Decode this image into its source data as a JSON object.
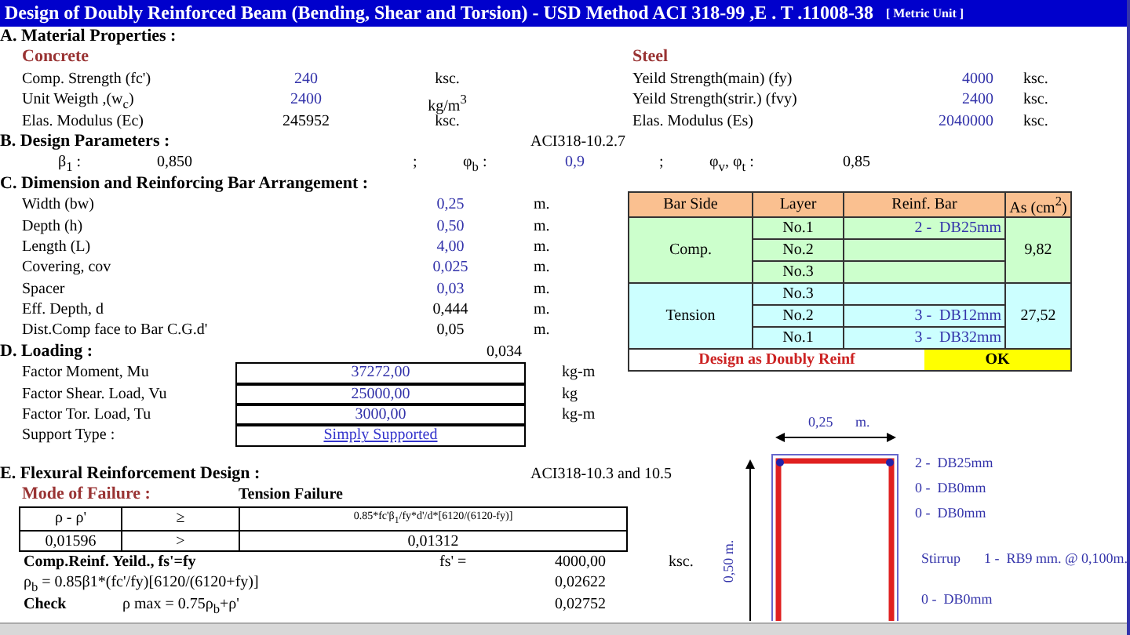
{
  "title": {
    "text": "Design of Doubly Reinforced Beam (Bending, Shear and Torsion) - USD Method ACI 318-99 ,E . T .11008-38",
    "unit_tag": "[ Metric Unit ]"
  },
  "material": {
    "heading": "A. Material Properties :",
    "concrete": {
      "heading": "Concrete",
      "rows": [
        {
          "label": "Comp. Strength (fc')",
          "value": "240",
          "unit": "ksc.",
          "input": true
        },
        {
          "label": "Unit Weigth ,(w$_{c}$)",
          "value": "2400",
          "unit": "kg/m$^{3}$",
          "input": true
        },
        {
          "label": "Elas. Modulus (Ec)",
          "value": "245952",
          "unit": "ksc.",
          "input": false
        }
      ]
    },
    "steel": {
      "heading": "Steel",
      "rows": [
        {
          "label": "Yeild Strength(main) (fy)",
          "value": "4000",
          "unit": "ksc.",
          "input": true
        },
        {
          "label": "Yeild Strength(strir.) (fvy)",
          "value": "2400",
          "unit": "ksc.",
          "input": true
        },
        {
          "label": "Elas. Modulus (Es)",
          "value": "2040000",
          "unit": "ksc.",
          "input": true
        }
      ]
    }
  },
  "design_parameters": {
    "heading": "B. Design Parameters :",
    "reference": "ACI318-10.2.7",
    "items": [
      {
        "symbol": "β$_{1}$ :",
        "value": "0,850",
        "input": false
      },
      {
        "separator": ";",
        "symbol": "φ$_{b}$ :",
        "value": "0,9",
        "input": true
      },
      {
        "separator": ";",
        "symbol": "φ$_{v}$, φ$_{t}$ :",
        "value": "0,85",
        "input": false
      }
    ]
  },
  "dimensions": {
    "heading": "C. Dimension and Reinforcing Bar Arrangement :",
    "rows": [
      {
        "label": "Width (bw)",
        "value": "0,25",
        "unit": "m.",
        "input": true
      },
      {
        "label": "Depth (h)",
        "value": "0,50",
        "unit": "m.",
        "input": true
      },
      {
        "label": "Length (L)",
        "value": "4,00",
        "unit": "m.",
        "input": true
      },
      {
        "label": "Covering, cov",
        "value": "0,025",
        "unit": "m.",
        "input": true
      },
      {
        "label": "Spacer",
        "value": "0,03",
        "unit": "m.",
        "input": true
      },
      {
        "label": "Eff. Depth, d",
        "value": "0,444",
        "unit": "m.",
        "input": false
      },
      {
        "label": "Dist.Comp face to Bar C.G.d'",
        "value": "0,05",
        "unit": "m.",
        "input": false
      }
    ]
  },
  "loading": {
    "heading": "D. Loading :",
    "note": "0,034",
    "rows": [
      {
        "label": "Factor Moment, Mu",
        "value": "37272,00",
        "unit": "kg-m",
        "kind": "number"
      },
      {
        "label": "Factor Shear. Load, Vu",
        "value": "25000,00",
        "unit": "kg",
        "kind": "number"
      },
      {
        "label": "Factor Tor. Load, Tu",
        "value": "3000,00",
        "unit": "kg-m",
        "kind": "number"
      },
      {
        "label": "Support  Type :",
        "value": "Simply Supported",
        "kind": "link"
      }
    ]
  },
  "bar_table": {
    "columns": [
      "Bar Side",
      "Layer",
      "Reinf. Bar",
      "As (cm$^{2}$)"
    ],
    "groups": [
      {
        "side": "Comp.",
        "color": "#ccffcc",
        "area": "9,82",
        "layers": [
          {
            "layer": "No.1",
            "bar": "2 -  DB25mm"
          },
          {
            "layer": "No.2"
          },
          {
            "layer": "No.3"
          }
        ]
      },
      {
        "side": "Tension",
        "color": "#ccffff",
        "area": "27,52",
        "layers": [
          {
            "layer": "No.3"
          },
          {
            "layer": "No.2",
            "bar": "3 -  DB12mm"
          },
          {
            "layer": "No.1",
            "bar": "3 -  DB32mm"
          }
        ]
      }
    ],
    "result": {
      "design": "Design as Doubly Reinf",
      "status": "OK"
    }
  },
  "flexural": {
    "heading": "E. Flexural Reinforcement Design :",
    "reference": "ACI318-10.3 and 10.5",
    "mode_label": "Mode of Failure :",
    "mode": "Tension Failure",
    "check_table": [
      [
        "ρ - ρ'",
        "≥",
        "0.85*fc'β$_{1}$/fy*d'/d*[6120/(6120-fy)]"
      ],
      [
        "0,01596",
        ">",
        "0,01312"
      ]
    ],
    "lines": [
      {
        "kind": "bold",
        "label": "Comp.Reinf. Yeild., fs'=fy",
        "symbol": "fs' =",
        "value": "4000,00",
        "unit": "ksc."
      },
      {
        "kind": "plain",
        "label": "ρ$_{b}$ = 0.85β1*(fc'/fy)[6120/(6120+fy)]",
        "value": "0,02622"
      },
      {
        "kind": "bold",
        "label": "Check",
        "formula": "ρ max = 0.75ρ$_{b}$+ρ'",
        "value": "0,02752"
      }
    ]
  },
  "section_drawing": {
    "width_label": "0,25",
    "width_unit": "m.",
    "depth_label": "0,50 m.",
    "top_bars": [
      "2 -  DB25mm",
      "0 -  DB0mm",
      "0 -  DB0mm"
    ],
    "stirrup_label": "Stirrup",
    "stirrup_value": "1 -  RB9 mm. @ 0,100m.",
    "bottom_bars": [
      "0 -  DB0mm"
    ]
  }
}
